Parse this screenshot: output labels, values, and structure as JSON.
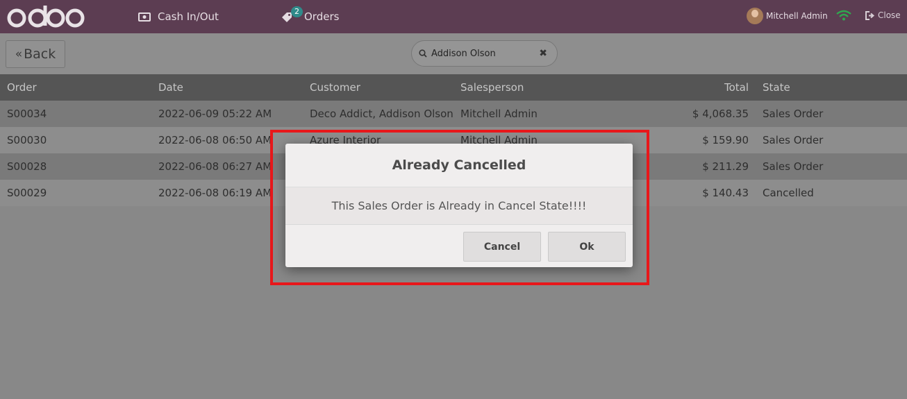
{
  "topbar": {
    "logo_text": "odoo",
    "nav": {
      "cash_label": "Cash In/Out",
      "orders_label": "Orders",
      "orders_badge": "2"
    },
    "user_name": "Mitchell Admin",
    "close_label": "Close",
    "icons": [
      "cash-icon",
      "tag-icon",
      "avatar",
      "wifi-icon",
      "sign-out-icon"
    ]
  },
  "toolbar": {
    "back_label": "Back",
    "search_value": "Addison Olson"
  },
  "table": {
    "columns": [
      "Order",
      "Date",
      "Customer",
      "Salesperson",
      "Total",
      "State"
    ],
    "rows": [
      [
        "S00034",
        "2022-06-09 05:22 AM",
        "Deco Addict, Addison Olson",
        "Mitchell Admin",
        "$ 4,068.35",
        "Sales Order"
      ],
      [
        "S00030",
        "2022-06-08 06:50 AM",
        "Azure Interior",
        "Mitchell Admin",
        "$ 159.90",
        "Sales Order"
      ],
      [
        "S00028",
        "2022-06-08 06:27 AM",
        "",
        "",
        "$ 211.29",
        "Sales Order"
      ],
      [
        "S00029",
        "2022-06-08 06:19 AM",
        "",
        "",
        "$ 140.43",
        "Cancelled"
      ]
    ]
  },
  "dialog": {
    "title": "Already Cancelled",
    "message": "This Sales Order is Already in Cancel State!!!!",
    "cancel_label": "Cancel",
    "ok_label": "Ok"
  },
  "colors": {
    "topbar": "#5c3d52",
    "highlight": "#e8171a",
    "badge": "#2f8a8a"
  }
}
